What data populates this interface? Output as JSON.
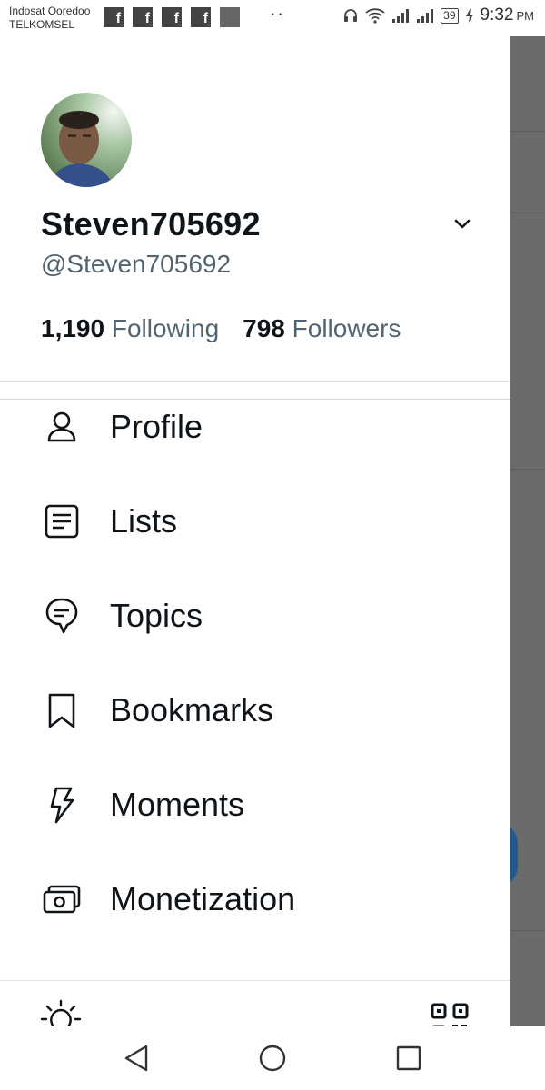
{
  "status_bar": {
    "carrier_1": "Indosat Ooredoo",
    "carrier_2": "TELKOMSEL",
    "notification_icons": [
      "facebook-icon",
      "facebook-icon",
      "facebook-icon",
      "facebook-icon",
      "image-icon"
    ],
    "dots": "··",
    "battery": "39",
    "time": "9:32",
    "ampm": "PM"
  },
  "profile": {
    "display_name": "Steven705692",
    "handle": "@Steven705692",
    "following_count": "1,190",
    "following_label": "Following",
    "followers_count": "798",
    "followers_label": "Followers"
  },
  "menu": [
    {
      "label": "Profile",
      "icon": "person-icon"
    },
    {
      "label": "Lists",
      "icon": "list-icon"
    },
    {
      "label": "Topics",
      "icon": "topics-icon"
    },
    {
      "label": "Bookmarks",
      "icon": "bookmark-icon"
    },
    {
      "label": "Moments",
      "icon": "lightning-icon"
    },
    {
      "label": "Monetization",
      "icon": "money-icon"
    }
  ],
  "footer": {
    "left_icon": "lightbulb-icon",
    "right_icon": "qr-code-icon"
  },
  "colors": {
    "text": "#0f1419",
    "secondary": "#536471",
    "overlay": "#6b6b6b",
    "divider": "#dfe4e8"
  }
}
